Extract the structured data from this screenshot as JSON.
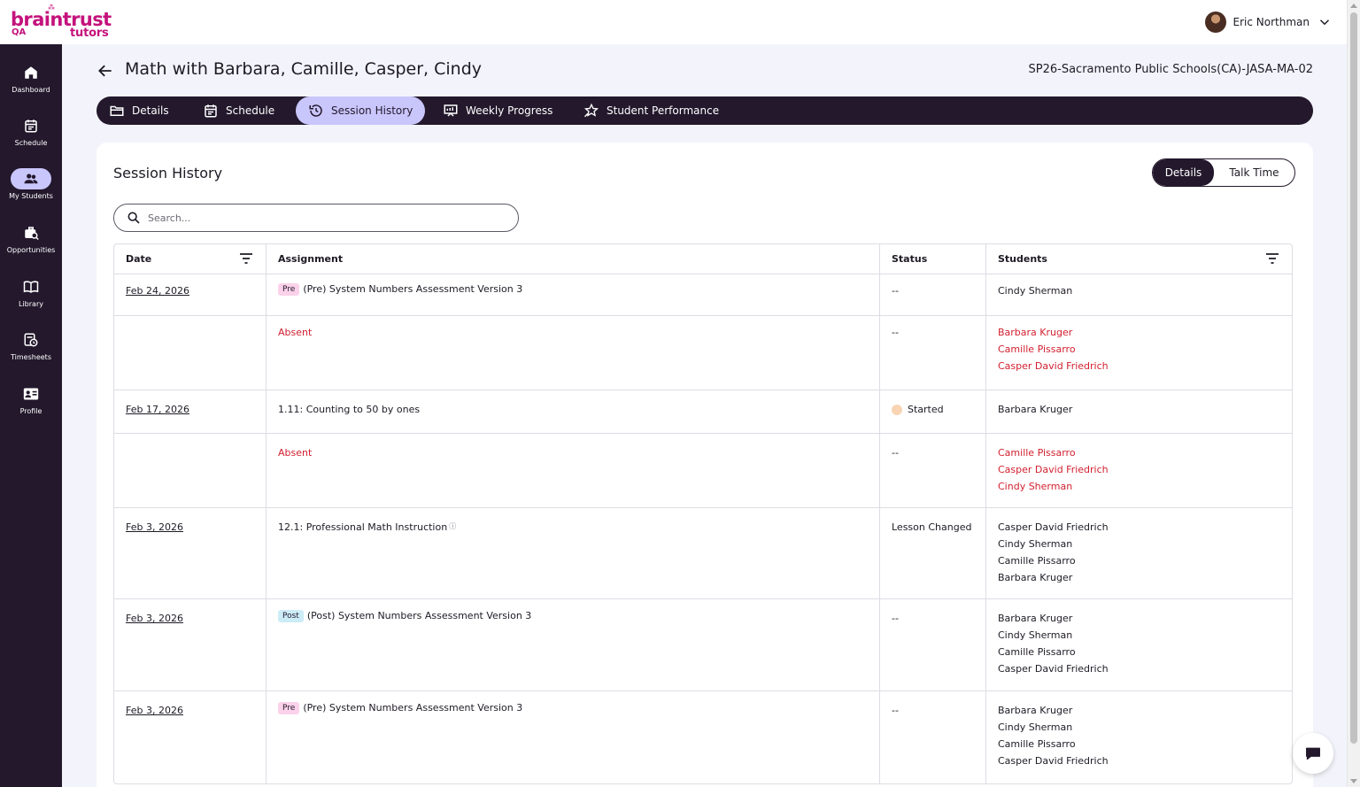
{
  "brand": {
    "name": "braintrust",
    "sub": "tutors",
    "env": "QA"
  },
  "user": {
    "name": "Eric Northman"
  },
  "sidebar": {
    "items": [
      {
        "label": "Dashboard",
        "icon": "home-icon"
      },
      {
        "label": "Schedule",
        "icon": "calendar-icon"
      },
      {
        "label": "My Students",
        "icon": "people-icon"
      },
      {
        "label": "Opportunities",
        "icon": "briefcase-search-icon"
      },
      {
        "label": "Library",
        "icon": "book-icon"
      },
      {
        "label": "Timesheets",
        "icon": "timesheet-icon"
      },
      {
        "label": "Profile",
        "icon": "profile-card-icon"
      }
    ]
  },
  "header": {
    "title": "Math with Barbara, Camille, Casper, Cindy",
    "code": "SP26-Sacramento Public Schools(CA)-JASA-MA-02"
  },
  "tabs": [
    {
      "label": "Details",
      "icon": "folder-icon"
    },
    {
      "label": "Schedule",
      "icon": "calendar-icon"
    },
    {
      "label": "Session History",
      "icon": "history-icon"
    },
    {
      "label": "Weekly Progress",
      "icon": "progress-icon"
    },
    {
      "label": "Student Performance",
      "icon": "star-chart-icon"
    }
  ],
  "card": {
    "title": "Session History",
    "toggle": {
      "details": "Details",
      "talk_time": "Talk Time"
    },
    "search": {
      "placeholder": "Search..."
    }
  },
  "table": {
    "headers": {
      "date": "Date",
      "assignment": "Assignment",
      "status": "Status",
      "students": "Students"
    },
    "rows": [
      {
        "date": "Feb 24, 2026",
        "badge": "Pre",
        "assignment": "(Pre) System Numbers Assessment Version 3",
        "status": "--",
        "students": [
          "Cindy Sherman"
        ]
      },
      {
        "date": "",
        "assignment": "Absent",
        "status": "--",
        "students": [
          "Barbara Kruger",
          "Camille Pissarro",
          "Casper David Friedrich"
        ]
      },
      {
        "date": "Feb 17, 2026",
        "assignment": "1.11: Counting to 50 by ones",
        "status": "Started",
        "students": [
          "Barbara Kruger"
        ]
      },
      {
        "date": "",
        "assignment": "Absent",
        "status": "--",
        "students": [
          "Camille Pissarro",
          "Casper David Friedrich",
          "Cindy Sherman"
        ]
      },
      {
        "date": "Feb 3, 2026",
        "assignment": "12.1: Professional Math Instruction",
        "status": "Lesson Changed",
        "students": [
          "Casper David Friedrich",
          "Cindy Sherman",
          "Camille Pissarro",
          "Barbara Kruger"
        ]
      },
      {
        "date": "Feb 3, 2026",
        "badge": "Post",
        "assignment": "(Post) System Numbers Assessment Version 3",
        "status": "--",
        "students": [
          "Barbara Kruger",
          "Cindy Sherman",
          "Camille Pissarro",
          "Casper David Friedrich"
        ]
      },
      {
        "date": "Feb 3, 2026",
        "badge": "Pre",
        "assignment": "(Pre) System Numbers Assessment Version 3",
        "status": "--",
        "students": [
          "Barbara Kruger",
          "Cindy Sherman",
          "Camille Pissarro",
          "Casper David Friedrich"
        ]
      }
    ]
  },
  "colors": {
    "brand": "#c4127c",
    "sidebar": "#23182c",
    "active": "#c9c6fb",
    "absent": "#d21f2f"
  }
}
